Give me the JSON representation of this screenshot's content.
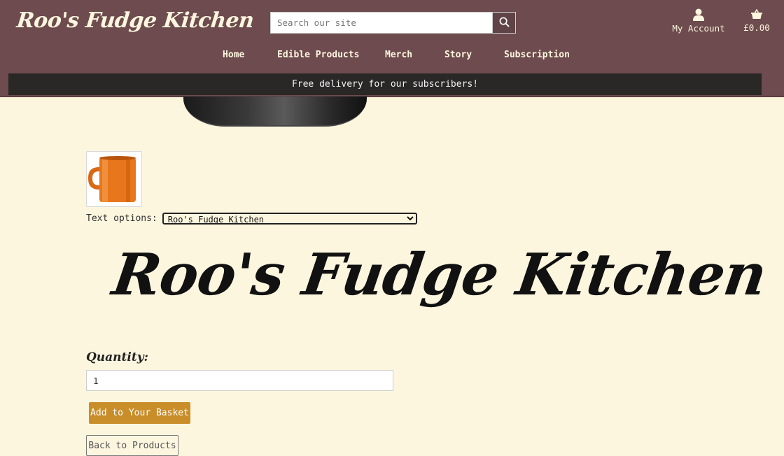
{
  "header": {
    "logo": "Roo's Fudge Kitchen",
    "search": {
      "placeholder": "Search our site",
      "value": ""
    },
    "account_label": "My Account",
    "basket_total": "£0.00",
    "nav": [
      "Home",
      "Edible Products",
      "Merch",
      "Story",
      "Subscription"
    ],
    "banner": "Free delivery for our subscribers!"
  },
  "product": {
    "text_options_label": "Text options:",
    "text_option_selected": "Roo's Fudge Kitchen",
    "preview_text": "Roo's Fudge Kitchen",
    "quantity_label": "Quantity:",
    "quantity_value": "1",
    "add_button": "Add to Your Basket",
    "back_button": "Back to Products"
  },
  "colors": {
    "header_bg": "#6d4b4e",
    "banner_bg": "#2a2727",
    "page_bg": "#fdf6df",
    "accent_button": "#c98e2a",
    "mug_color": "#e8761c"
  },
  "icons": [
    "search-icon",
    "user-icon",
    "basket-icon"
  ]
}
